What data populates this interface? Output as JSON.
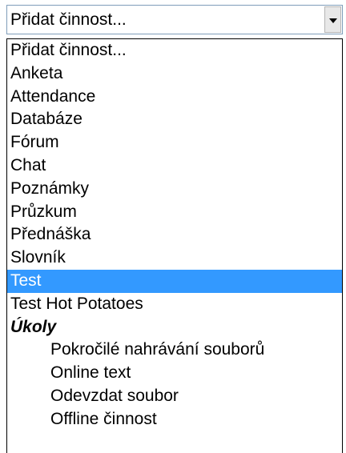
{
  "select": {
    "value": "Přidat činnost...",
    "icon": "chevron-down-icon"
  },
  "options": [
    {
      "label": "Přidat činnost...",
      "kind": "option"
    },
    {
      "label": "Anketa",
      "kind": "option"
    },
    {
      "label": "Attendance",
      "kind": "option"
    },
    {
      "label": "Databáze",
      "kind": "option"
    },
    {
      "label": "Fórum",
      "kind": "option"
    },
    {
      "label": "Chat",
      "kind": "option"
    },
    {
      "label": "Poznámky",
      "kind": "option"
    },
    {
      "label": "Průzkum",
      "kind": "option"
    },
    {
      "label": "Přednáška",
      "kind": "option"
    },
    {
      "label": "Slovník",
      "kind": "option"
    },
    {
      "label": "Test",
      "kind": "option",
      "selected": true
    },
    {
      "label": "Test Hot Potatoes",
      "kind": "option"
    },
    {
      "label": "Úkoly",
      "kind": "group"
    },
    {
      "label": "Pokročilé nahrávání souborů",
      "kind": "child"
    },
    {
      "label": "Online text",
      "kind": "child"
    },
    {
      "label": "Odevzdat soubor",
      "kind": "child"
    },
    {
      "label": "Offline činnost",
      "kind": "child"
    }
  ],
  "colors": {
    "highlight": "#3399ff",
    "highlight_text": "#ffffff"
  }
}
